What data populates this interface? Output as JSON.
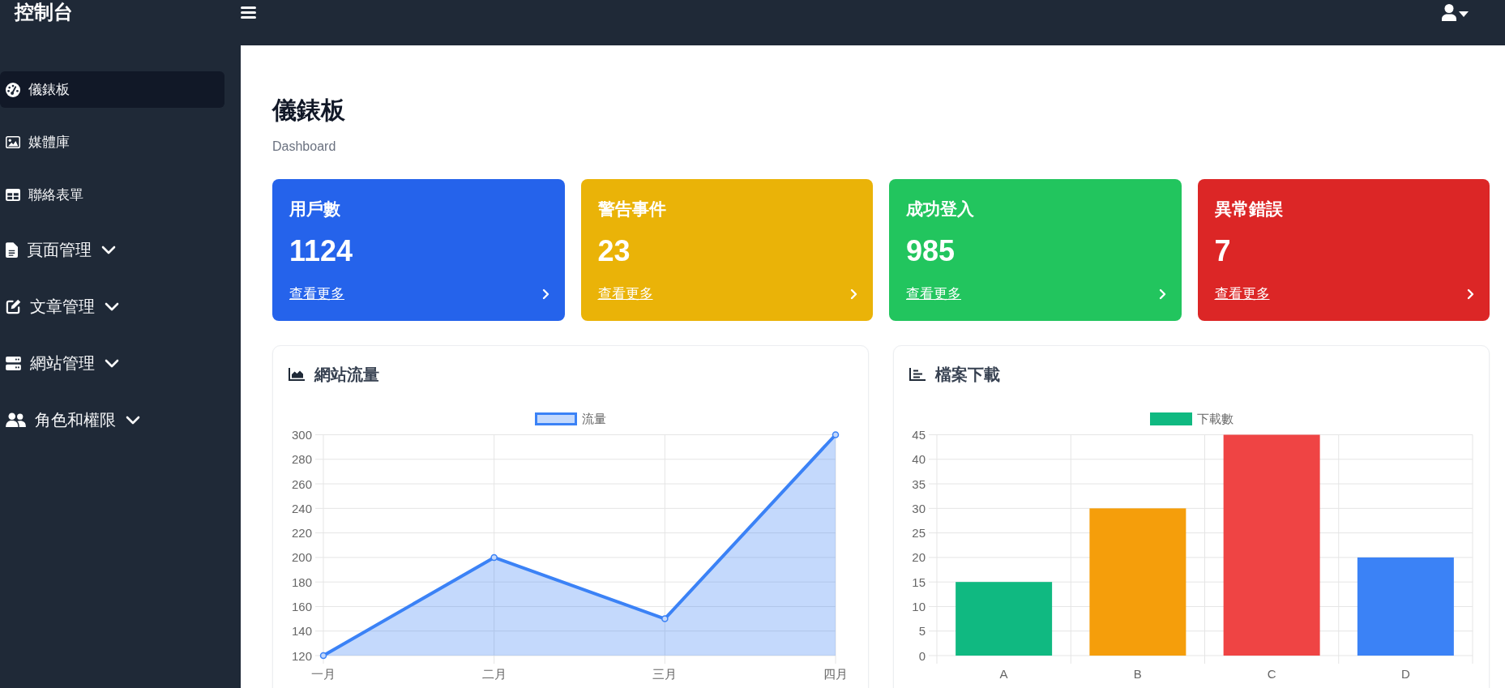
{
  "topbar": {
    "title": "控制台"
  },
  "sidebar": {
    "items": [
      {
        "label": "儀錶板",
        "kind": "link",
        "selected": true
      },
      {
        "label": "媒體庫",
        "kind": "link",
        "selected": false
      },
      {
        "label": "聯絡表單",
        "kind": "link",
        "selected": false
      },
      {
        "label": "頁面管理",
        "kind": "group",
        "selected": false
      },
      {
        "label": "文章管理",
        "kind": "group",
        "selected": false
      },
      {
        "label": "網站管理",
        "kind": "group",
        "selected": false
      },
      {
        "label": "角色和權限",
        "kind": "group",
        "selected": false
      }
    ]
  },
  "page": {
    "title": "儀錶板",
    "subtitle": "Dashboard"
  },
  "stat_cards": [
    {
      "title": "用戶數",
      "value": "1124",
      "link": "查看更多",
      "color": "#2563eb"
    },
    {
      "title": "警告事件",
      "value": "23",
      "link": "查看更多",
      "color": "#eab308"
    },
    {
      "title": "成功登入",
      "value": "985",
      "link": "查看更多",
      "color": "#22c55e"
    },
    {
      "title": "異常錯誤",
      "value": "7",
      "link": "查看更多",
      "color": "#dc2626"
    }
  ],
  "panels": [
    {
      "title": "網站流量",
      "chart_data": {
        "type": "area",
        "categories": [
          "一月",
          "二月",
          "三月",
          "四月"
        ],
        "series": [
          {
            "name": "流量",
            "color": "#3b82f6",
            "values": [
              120,
              200,
              150,
              300
            ]
          }
        ],
        "ylim": [
          120,
          300
        ],
        "yticks": [
          120,
          140,
          160,
          180,
          200,
          220,
          240,
          260,
          280,
          300
        ],
        "grid": true
      }
    },
    {
      "title": "檔案下載",
      "chart_data": {
        "type": "bar",
        "categories": [
          "A",
          "B",
          "C",
          "D"
        ],
        "series": [
          {
            "name": "下載數",
            "color": "#10b981",
            "colors": [
              "#10b981",
              "#f59e0b",
              "#ef4444",
              "#3b82f6"
            ],
            "values": [
              15,
              30,
              45,
              20
            ]
          }
        ],
        "ylim": [
          0,
          45
        ],
        "yticks": [
          0,
          5,
          10,
          15,
          20,
          25,
          30,
          35,
          40,
          45
        ],
        "grid": true
      }
    }
  ]
}
